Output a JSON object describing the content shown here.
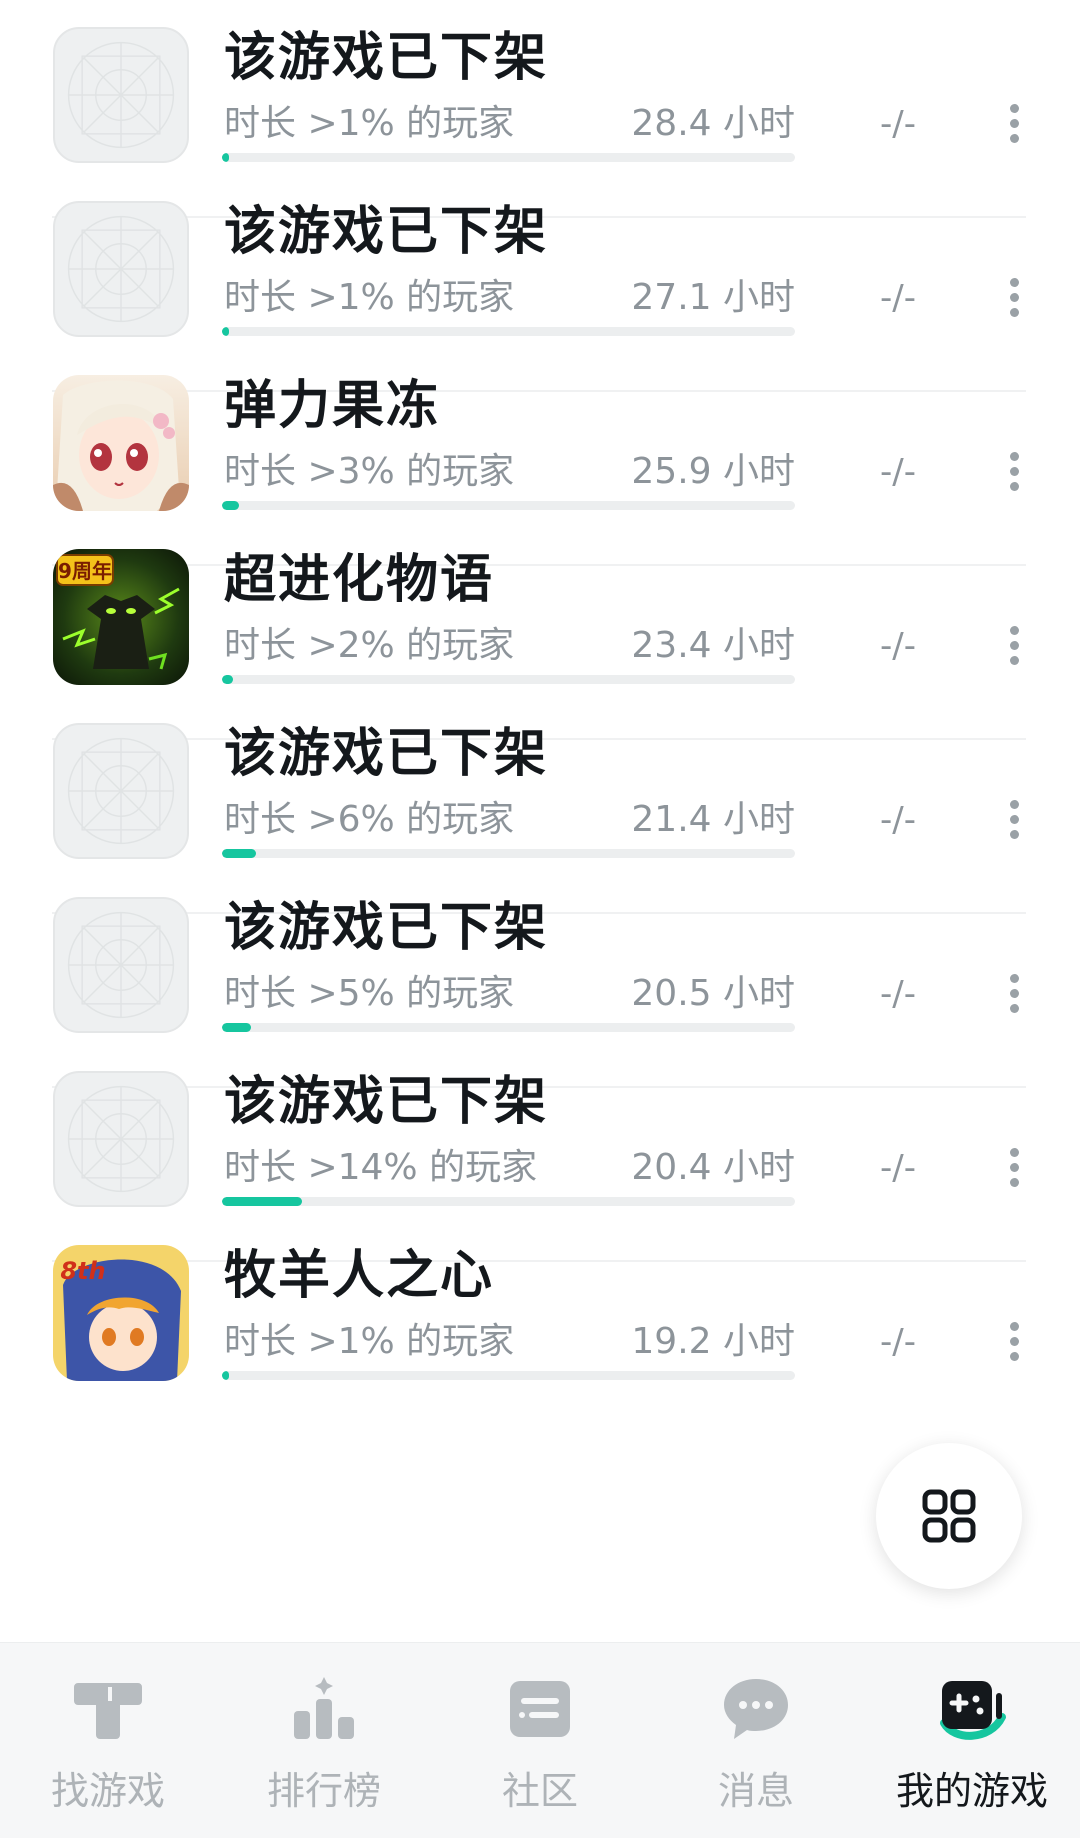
{
  "games": [
    {
      "title": "该游戏已下架",
      "subtitle": "时长 >1% 的玩家",
      "hours": "28.4 小时",
      "rating": "-/-",
      "progress": 0.01,
      "icon": "placeholder-icon"
    },
    {
      "title": "该游戏已下架",
      "subtitle": "时长 >1% 的玩家",
      "hours": "27.1 小时",
      "rating": "-/-",
      "progress": 0.01,
      "icon": "placeholder-icon"
    },
    {
      "title": "弹力果冻",
      "subtitle": "时长 >3% 的玩家",
      "hours": "25.9 小时",
      "rating": "-/-",
      "progress": 0.03,
      "icon": "anime-girl-game-icon"
    },
    {
      "title": "超进化物语",
      "subtitle": "时长 >2% 的玩家",
      "hours": "23.4 小时",
      "rating": "-/-",
      "progress": 0.02,
      "icon": "monster-game-icon",
      "badge": "9周年"
    },
    {
      "title": "该游戏已下架",
      "subtitle": "时长 >6% 的玩家",
      "hours": "21.4 小时",
      "rating": "-/-",
      "progress": 0.06,
      "icon": "placeholder-icon"
    },
    {
      "title": "该游戏已下架",
      "subtitle": "时长 >5% 的玩家",
      "hours": "20.5 小时",
      "rating": "-/-",
      "progress": 0.05,
      "icon": "placeholder-icon"
    },
    {
      "title": "该游戏已下架",
      "subtitle": "时长 >14% 的玩家",
      "hours": "20.4 小时",
      "rating": "-/-",
      "progress": 0.14,
      "icon": "placeholder-icon"
    },
    {
      "title": "牧羊人之心",
      "subtitle": "时长 >1% 的玩家",
      "hours": "19.2 小时",
      "rating": "-/-",
      "progress": 0.01,
      "icon": "anime-character-game-icon",
      "badge": "8th"
    }
  ],
  "fab": {
    "icon": "grid-icon"
  },
  "tabs": [
    {
      "label": "找游戏",
      "icon": "find-games-icon",
      "active": false
    },
    {
      "label": "排行榜",
      "icon": "ranking-icon",
      "active": false
    },
    {
      "label": "社区",
      "icon": "community-icon",
      "active": false
    },
    {
      "label": "消息",
      "icon": "message-icon",
      "active": false
    },
    {
      "label": "我的游戏",
      "icon": "my-games-icon",
      "active": true
    }
  ],
  "colors": {
    "accent": "#16c69f",
    "text": "#14181c",
    "muted": "#8d949a",
    "inactive_tab": "#aeb3b7"
  }
}
